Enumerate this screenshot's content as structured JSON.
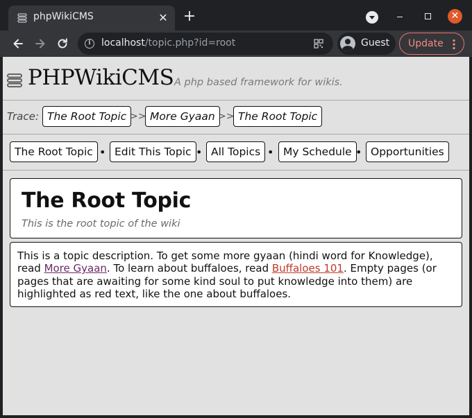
{
  "browser": {
    "tab": {
      "title": "phpWikiCMS",
      "favicon": "stack-icon"
    },
    "url_host": "localhost",
    "url_path": "/topic.php?id=root",
    "profile_label": "Guest",
    "update_label": "Update"
  },
  "site": {
    "title": "PHPWikiCMS",
    "tagline": "A php based framework for wikis."
  },
  "trace": {
    "label": "Trace:",
    "separator": ">>",
    "crumbs": [
      "The Root Topic",
      "More Gyaan",
      "The Root Topic"
    ]
  },
  "menu": {
    "separator": "•",
    "items": [
      "The Root Topic",
      "Edit This Topic",
      "All Topics",
      "My Schedule",
      "Opportunities"
    ]
  },
  "topic": {
    "title": "The Root Topic",
    "subtitle": "This is the root topic of the wiki"
  },
  "description": {
    "part1": "This is a topic description. To get some more gyaan (hindi word for Knowledge), read ",
    "link1": "More Gyaan",
    "part2": ". To learn about buffaloes, read ",
    "link2": "Buffaloes 101",
    "part3": ". Empty pages (or pages that are awaiting for some kind soul to put knowledge into them) are highlighted as red text, like the one about buffaloes."
  },
  "colors": {
    "existing_link": "#6a2a6a",
    "missing_link": "#c0392b",
    "page_bg": "#e1e1e1",
    "update_accent": "#f28b82"
  }
}
